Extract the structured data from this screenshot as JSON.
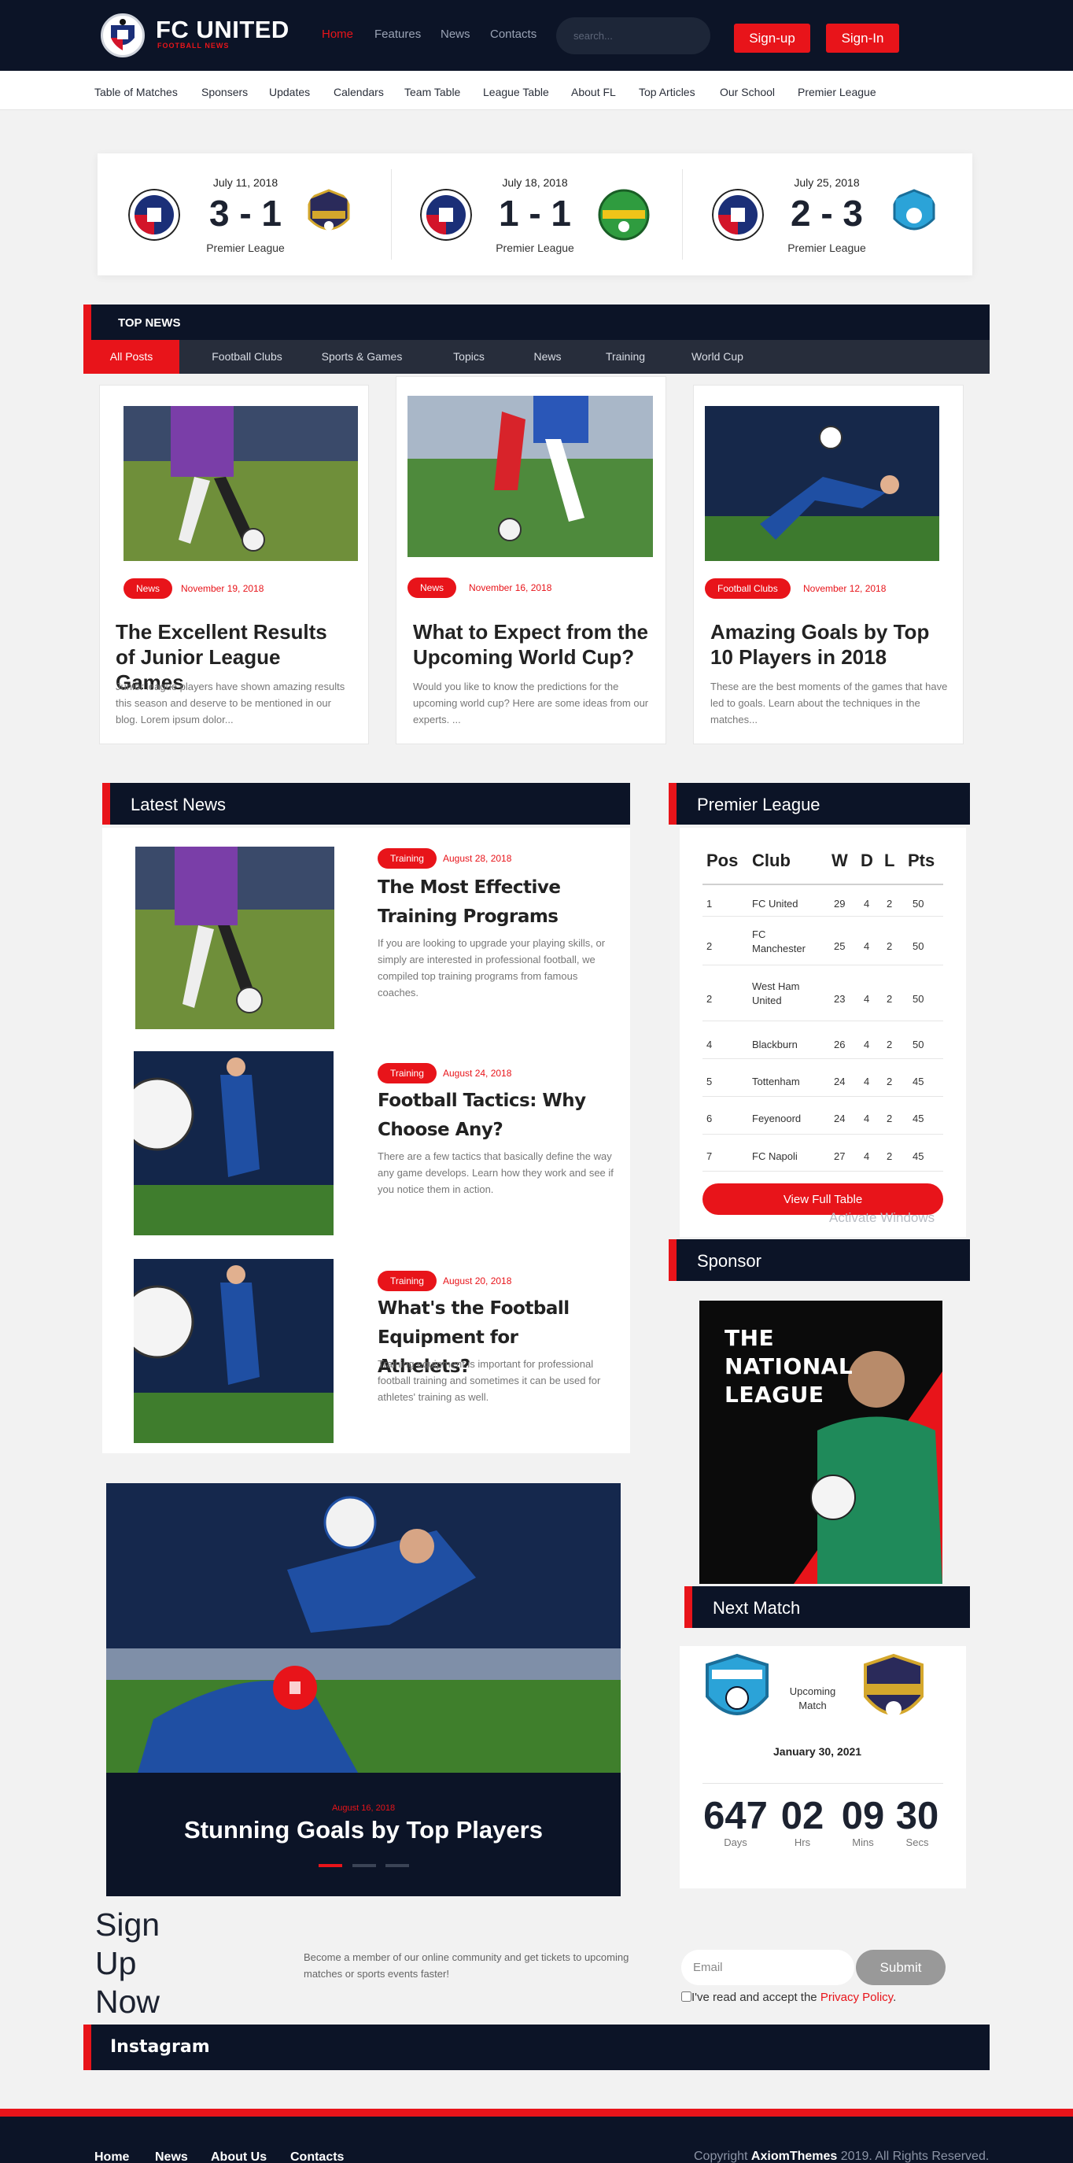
{
  "brand": {
    "name": "FC UNITED",
    "tagline": "FOOTBALL NEWS"
  },
  "nav": {
    "home": "Home",
    "features": "Features",
    "news": "News",
    "contacts": "Contacts"
  },
  "search": {
    "placeholder": "search..."
  },
  "auth": {
    "signup": "Sign-up",
    "signin": "Sign-In"
  },
  "subnav": [
    "Table of Matches",
    "Sponsers",
    "Updates",
    "Calendars",
    "Team Table",
    "League Table",
    "About FL",
    "Top Articles",
    "Our School",
    "Premier League"
  ],
  "matches": [
    {
      "date": "July 11, 2018",
      "score": "3 - 1",
      "league": "Premier League"
    },
    {
      "date": "July 18, 2018",
      "score": "1 - 1",
      "league": "Premier League"
    },
    {
      "date": "July 25, 2018",
      "score": "2 - 3",
      "league": "Premier League"
    }
  ],
  "top_news": {
    "title": "TOP NEWS",
    "tabs": [
      "All Posts",
      "Football Clubs",
      "Sports & Games",
      "Topics",
      "News",
      "Training",
      "World Cup"
    ],
    "cards": [
      {
        "tag": "News",
        "date": "November 19, 2018",
        "title": "The Excellent Results of Junior League Games",
        "excerpt": "Junior league players have shown amazing results this season and deserve to be mentioned in our blog. Lorem ipsum dolor..."
      },
      {
        "tag": "News",
        "date": "November 16, 2018",
        "title": "What to Expect from the Upcoming World Cup?",
        "excerpt": "Would you like to know the predictions for the upcoming world cup? Here are some ideas from our experts. ..."
      },
      {
        "tag": "Football Clubs",
        "date": "November 12, 2018",
        "title": "Amazing Goals by Top 10 Players in 2018",
        "excerpt": "These are the best moments of the games that have led to goals. Learn about the techniques in the matches..."
      }
    ]
  },
  "latest_news": {
    "title": "Latest News",
    "items": [
      {
        "tag": "Training",
        "date": "August 28, 2018",
        "title": "The Most Effective Training Programs",
        "excerpt": "If you are looking to upgrade your playing skills, or simply are interested in professional football, we compiled top training programs from famous coaches."
      },
      {
        "tag": "Training",
        "date": "August 24, 2018",
        "title": "Football Tactics: Why Choose Any?",
        "excerpt": "There are a few tactics that basically define the way any game develops. Learn how they work and see if you notice them in action."
      },
      {
        "tag": "Training",
        "date": "August 20, 2018",
        "title": "What's the Football Equipment for Athelets?",
        "excerpt": "Training equipment is important for professional football training and sometimes it can be used for athletes' training as well."
      }
    ]
  },
  "league": {
    "title": "Premier League",
    "headers": [
      "Pos",
      "Club",
      "W",
      "D",
      "L",
      "Pts"
    ],
    "rows": [
      [
        "1",
        "FC United",
        "29",
        "4",
        "2",
        "50"
      ],
      [
        "2",
        "FC Manchester",
        "25",
        "4",
        "2",
        "50"
      ],
      [
        "2",
        "West Ham United",
        "23",
        "4",
        "2",
        "50"
      ],
      [
        "4",
        "Blackburn",
        "26",
        "4",
        "2",
        "50"
      ],
      [
        "5",
        "Tottenham",
        "24",
        "4",
        "2",
        "45"
      ],
      [
        "6",
        "Feyenoord",
        "24",
        "4",
        "2",
        "45"
      ],
      [
        "7",
        "FC Napoli",
        "27",
        "4",
        "2",
        "45"
      ]
    ],
    "button": "View Full Table",
    "watermark": "Activate Windows"
  },
  "sponsor": {
    "title": "Sponsor",
    "banner_text": "THE NATIONAL LEAGUE"
  },
  "next_match": {
    "title": "Next Match",
    "label": "Upcoming Match",
    "date": "January 30, 2021",
    "countdown": [
      {
        "value": "647",
        "label": "Days"
      },
      {
        "value": "02",
        "label": "Hrs"
      },
      {
        "value": "09",
        "label": "Mins"
      },
      {
        "value": "30",
        "label": "Secs"
      }
    ]
  },
  "hero": {
    "date": "August 16, 2018",
    "title": "Stunning Goals by Top Players"
  },
  "signup": {
    "title": "Sign Up Now",
    "description": "Become a member of our online community and get tickets to upcoming matches or sports events faster!",
    "email_placeholder": "Email",
    "submit": "Submit",
    "privacy_prefix": "I've read and accept the ",
    "privacy_link": "Privacy Policy",
    "privacy_suffix": "."
  },
  "instagram": {
    "title": "Instagram"
  },
  "footer": {
    "links": [
      "Home",
      "News",
      "About Us",
      "Contacts"
    ],
    "copyright_prefix": "Copyright ",
    "copyright_brand": "AxiomThemes",
    "copyright_suffix": " 2019. All Rights Reserved."
  },
  "colors": {
    "accent": "#e8141a",
    "navy": "#0c1427",
    "background": "#f2f2f2"
  }
}
